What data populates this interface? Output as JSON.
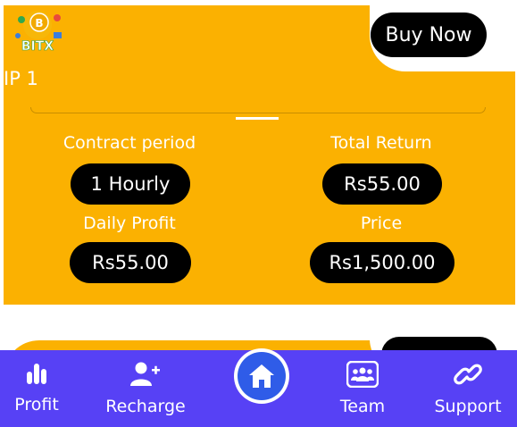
{
  "plan": {
    "name": "IP 1",
    "buy_label": "Buy Now",
    "logo_text": "BITX",
    "contract_label": "Contract period",
    "contract_value": "1 Hourly",
    "total_return_label": "Total Return",
    "total_return_value": "Rs55.00",
    "daily_profit_label": "Daily Profit",
    "daily_profit_value": "Rs55.00",
    "price_label": "Price",
    "price_value": "Rs1,500.00"
  },
  "nav": {
    "profit": "Profit",
    "recharge": "Recharge",
    "team": "Team",
    "support": "Support"
  },
  "colors": {
    "card": "#fbb101",
    "nav": "#5741f5",
    "home": "#2f5ce8"
  }
}
